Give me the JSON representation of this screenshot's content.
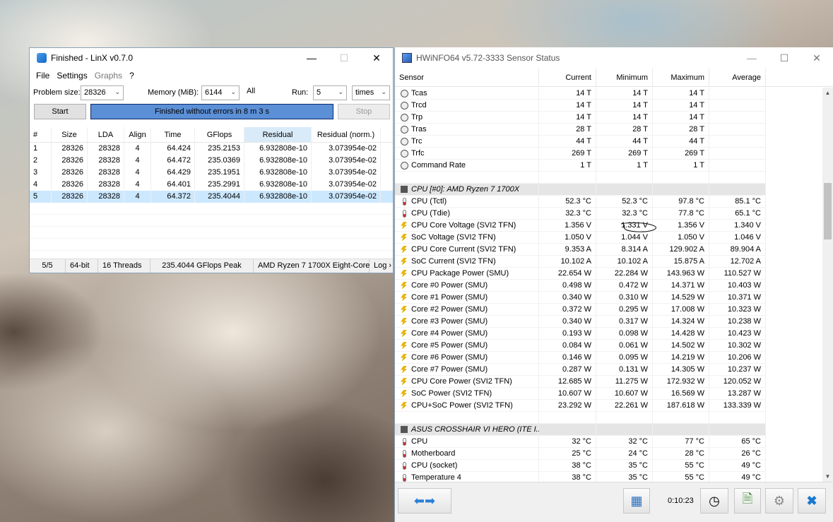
{
  "linx": {
    "title": "Finished - LinX v0.7.0",
    "menu": [
      "File",
      "Settings",
      "Graphs",
      "?"
    ],
    "problem_size_label": "Problem size:",
    "problem_size": "28326",
    "memory_label": "Memory (MiB):",
    "memory": "6144",
    "all_label": "All",
    "run_label": "Run:",
    "run": "5",
    "run_unit": "times",
    "start_label": "Start",
    "progress_text": "Finished without errors in 8 m 3 s",
    "stop_label": "Stop",
    "columns": [
      "#",
      "Size",
      "LDA",
      "Align",
      "Time",
      "GFlops",
      "Residual",
      "Residual (norm.)"
    ],
    "rows": [
      [
        "1",
        "28326",
        "28328",
        "4",
        "64.424",
        "235.2153",
        "6.932808e-10",
        "3.073954e-02"
      ],
      [
        "2",
        "28326",
        "28328",
        "4",
        "64.472",
        "235.0369",
        "6.932808e-10",
        "3.073954e-02"
      ],
      [
        "3",
        "28326",
        "28328",
        "4",
        "64.429",
        "235.1951",
        "6.932808e-10",
        "3.073954e-02"
      ],
      [
        "4",
        "28326",
        "28328",
        "4",
        "64.401",
        "235.2991",
        "6.932808e-10",
        "3.073954e-02"
      ],
      [
        "5",
        "28326",
        "28328",
        "4",
        "64.372",
        "235.4044",
        "6.932808e-10",
        "3.073954e-02"
      ]
    ],
    "status": [
      "5/5",
      "64-bit",
      "16 Threads",
      "235.4044 GFlops Peak",
      "AMD Ryzen 7 1700X Eight-Core",
      "Log ›"
    ]
  },
  "hwinfo": {
    "title": "HWiNFO64 v5.72-3333 Sensor Status",
    "columns": [
      "Sensor",
      "Current",
      "Minimum",
      "Maximum",
      "Average"
    ],
    "rows": [
      {
        "icon": "clock",
        "name": "Tcas",
        "cur": "14 T",
        "min": "14 T",
        "max": "14 T",
        "avg": ""
      },
      {
        "icon": "clock",
        "name": "Trcd",
        "cur": "14 T",
        "min": "14 T",
        "max": "14 T",
        "avg": ""
      },
      {
        "icon": "clock",
        "name": "Trp",
        "cur": "14 T",
        "min": "14 T",
        "max": "14 T",
        "avg": ""
      },
      {
        "icon": "clock",
        "name": "Tras",
        "cur": "28 T",
        "min": "28 T",
        "max": "28 T",
        "avg": ""
      },
      {
        "icon": "clock",
        "name": "Trc",
        "cur": "44 T",
        "min": "44 T",
        "max": "44 T",
        "avg": ""
      },
      {
        "icon": "clock",
        "name": "Trfc",
        "cur": "269 T",
        "min": "269 T",
        "max": "269 T",
        "avg": ""
      },
      {
        "icon": "clock",
        "name": "Command Rate",
        "cur": "1 T",
        "min": "1 T",
        "max": "1 T",
        "avg": ""
      },
      {
        "type": "blank"
      },
      {
        "type": "group",
        "name": "CPU [#0]: AMD Ryzen 7 1700X"
      },
      {
        "icon": "therm",
        "name": "CPU (Tctl)",
        "cur": "52.3 °C",
        "min": "52.3 °C",
        "max": "97.8 °C",
        "avg": "85.1 °C"
      },
      {
        "icon": "therm",
        "name": "CPU (Tdie)",
        "cur": "32.3 °C",
        "min": "32.3 °C",
        "max": "77.8 °C",
        "avg": "65.1 °C"
      },
      {
        "icon": "bolt",
        "name": "CPU Core Voltage (SVI2 TFN)",
        "cur": "1.356 V",
        "min": "1.331 V",
        "max": "1.356 V",
        "avg": "1.340 V"
      },
      {
        "icon": "bolt",
        "name": "SoC Voltage (SVI2 TFN)",
        "cur": "1.050 V",
        "min": "1.044 V",
        "max": "1.050 V",
        "avg": "1.046 V"
      },
      {
        "icon": "bolt",
        "name": "CPU Core Current (SVI2 TFN)",
        "cur": "9.353 A",
        "min": "8.314 A",
        "max": "129.902 A",
        "avg": "89.904 A"
      },
      {
        "icon": "bolt",
        "name": "SoC Current (SVI2 TFN)",
        "cur": "10.102 A",
        "min": "10.102 A",
        "max": "15.875 A",
        "avg": "12.702 A"
      },
      {
        "icon": "bolt",
        "name": "CPU Package Power (SMU)",
        "cur": "22.654 W",
        "min": "22.284 W",
        "max": "143.963 W",
        "avg": "110.527 W"
      },
      {
        "icon": "bolt",
        "name": "Core #0 Power (SMU)",
        "cur": "0.498 W",
        "min": "0.472 W",
        "max": "14.371 W",
        "avg": "10.403 W"
      },
      {
        "icon": "bolt",
        "name": "Core #1 Power (SMU)",
        "cur": "0.340 W",
        "min": "0.310 W",
        "max": "14.529 W",
        "avg": "10.371 W"
      },
      {
        "icon": "bolt",
        "name": "Core #2 Power (SMU)",
        "cur": "0.372 W",
        "min": "0.295 W",
        "max": "17.008 W",
        "avg": "10.323 W"
      },
      {
        "icon": "bolt",
        "name": "Core #3 Power (SMU)",
        "cur": "0.340 W",
        "min": "0.317 W",
        "max": "14.324 W",
        "avg": "10.238 W"
      },
      {
        "icon": "bolt",
        "name": "Core #4 Power (SMU)",
        "cur": "0.193 W",
        "min": "0.098 W",
        "max": "14.428 W",
        "avg": "10.423 W"
      },
      {
        "icon": "bolt",
        "name": "Core #5 Power (SMU)",
        "cur": "0.084 W",
        "min": "0.061 W",
        "max": "14.502 W",
        "avg": "10.302 W"
      },
      {
        "icon": "bolt",
        "name": "Core #6 Power (SMU)",
        "cur": "0.146 W",
        "min": "0.095 W",
        "max": "14.219 W",
        "avg": "10.206 W"
      },
      {
        "icon": "bolt",
        "name": "Core #7 Power (SMU)",
        "cur": "0.287 W",
        "min": "0.131 W",
        "max": "14.305 W",
        "avg": "10.237 W"
      },
      {
        "icon": "bolt",
        "name": "CPU Core Power (SVI2 TFN)",
        "cur": "12.685 W",
        "min": "11.275 W",
        "max": "172.932 W",
        "avg": "120.052 W"
      },
      {
        "icon": "bolt",
        "name": "SoC Power (SVI2 TFN)",
        "cur": "10.607 W",
        "min": "10.607 W",
        "max": "16.569 W",
        "avg": "13.287 W"
      },
      {
        "icon": "bolt",
        "name": "CPU+SoC Power (SVI2 TFN)",
        "cur": "23.292 W",
        "min": "22.261 W",
        "max": "187.618 W",
        "avg": "133.339 W"
      },
      {
        "type": "blank"
      },
      {
        "type": "group",
        "name": "ASUS CROSSHAIR VI HERO (ITE I..."
      },
      {
        "icon": "therm",
        "name": "CPU",
        "cur": "32 °C",
        "min": "32 °C",
        "max": "77 °C",
        "avg": "65 °C"
      },
      {
        "icon": "therm",
        "name": "Motherboard",
        "cur": "25 °C",
        "min": "24 °C",
        "max": "28 °C",
        "avg": "26 °C"
      },
      {
        "icon": "therm",
        "name": "CPU (socket)",
        "cur": "38 °C",
        "min": "35 °C",
        "max": "55 °C",
        "avg": "49 °C"
      },
      {
        "icon": "therm",
        "name": "Temperature 4",
        "cur": "38 °C",
        "min": "35 °C",
        "max": "55 °C",
        "avg": "49 °C"
      }
    ],
    "elapsed": "0:10:23"
  }
}
